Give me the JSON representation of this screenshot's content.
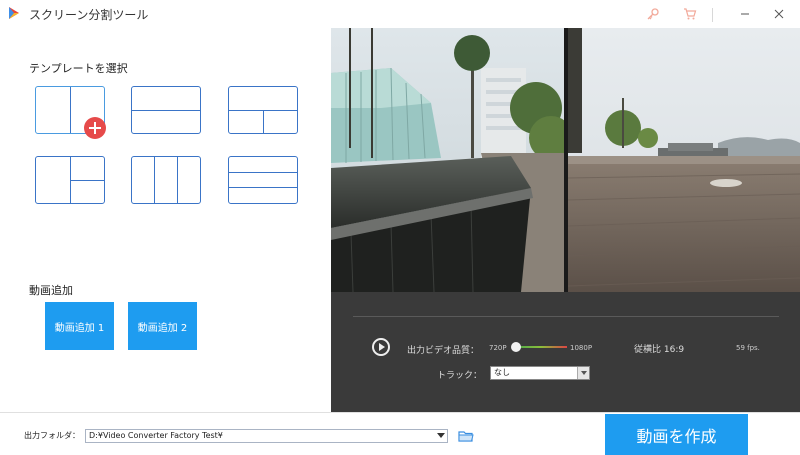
{
  "window": {
    "title": "スクリーン分割ツール",
    "icons": [
      "app-logo-icon",
      "key-icon",
      "cart-icon",
      "minimize-icon",
      "close-icon"
    ]
  },
  "templates": {
    "label": "テンプレートを選択",
    "items": [
      {
        "name": "two-vertical",
        "selected": true
      },
      {
        "name": "two-horizontal"
      },
      {
        "name": "top-plus-two-bottom"
      },
      {
        "name": "left-plus-two-right"
      },
      {
        "name": "three-vertical"
      },
      {
        "name": "three-horizontal"
      }
    ]
  },
  "add_video": {
    "label": "動画追加",
    "buttons": [
      "動画追加 1",
      "動画追加 2"
    ]
  },
  "controls": {
    "quality_label": "出力ビデオ品質：",
    "quality_min": "720P",
    "quality_max": "1080P",
    "quality_level": 0.0,
    "aspect_ratio": "従横比 16:9",
    "fps": "59 fps.",
    "track_label": "トラック：",
    "track_value": "なし"
  },
  "output": {
    "label": "出力フォルダ：",
    "path": "D:¥Video Converter Factory Test¥",
    "create_button": "動画を作成"
  },
  "colors": {
    "accent": "#1e9cf0",
    "template_border": "#3a74c7",
    "badge": "#e64a4a",
    "dark_panel": "#3a3a3a"
  }
}
